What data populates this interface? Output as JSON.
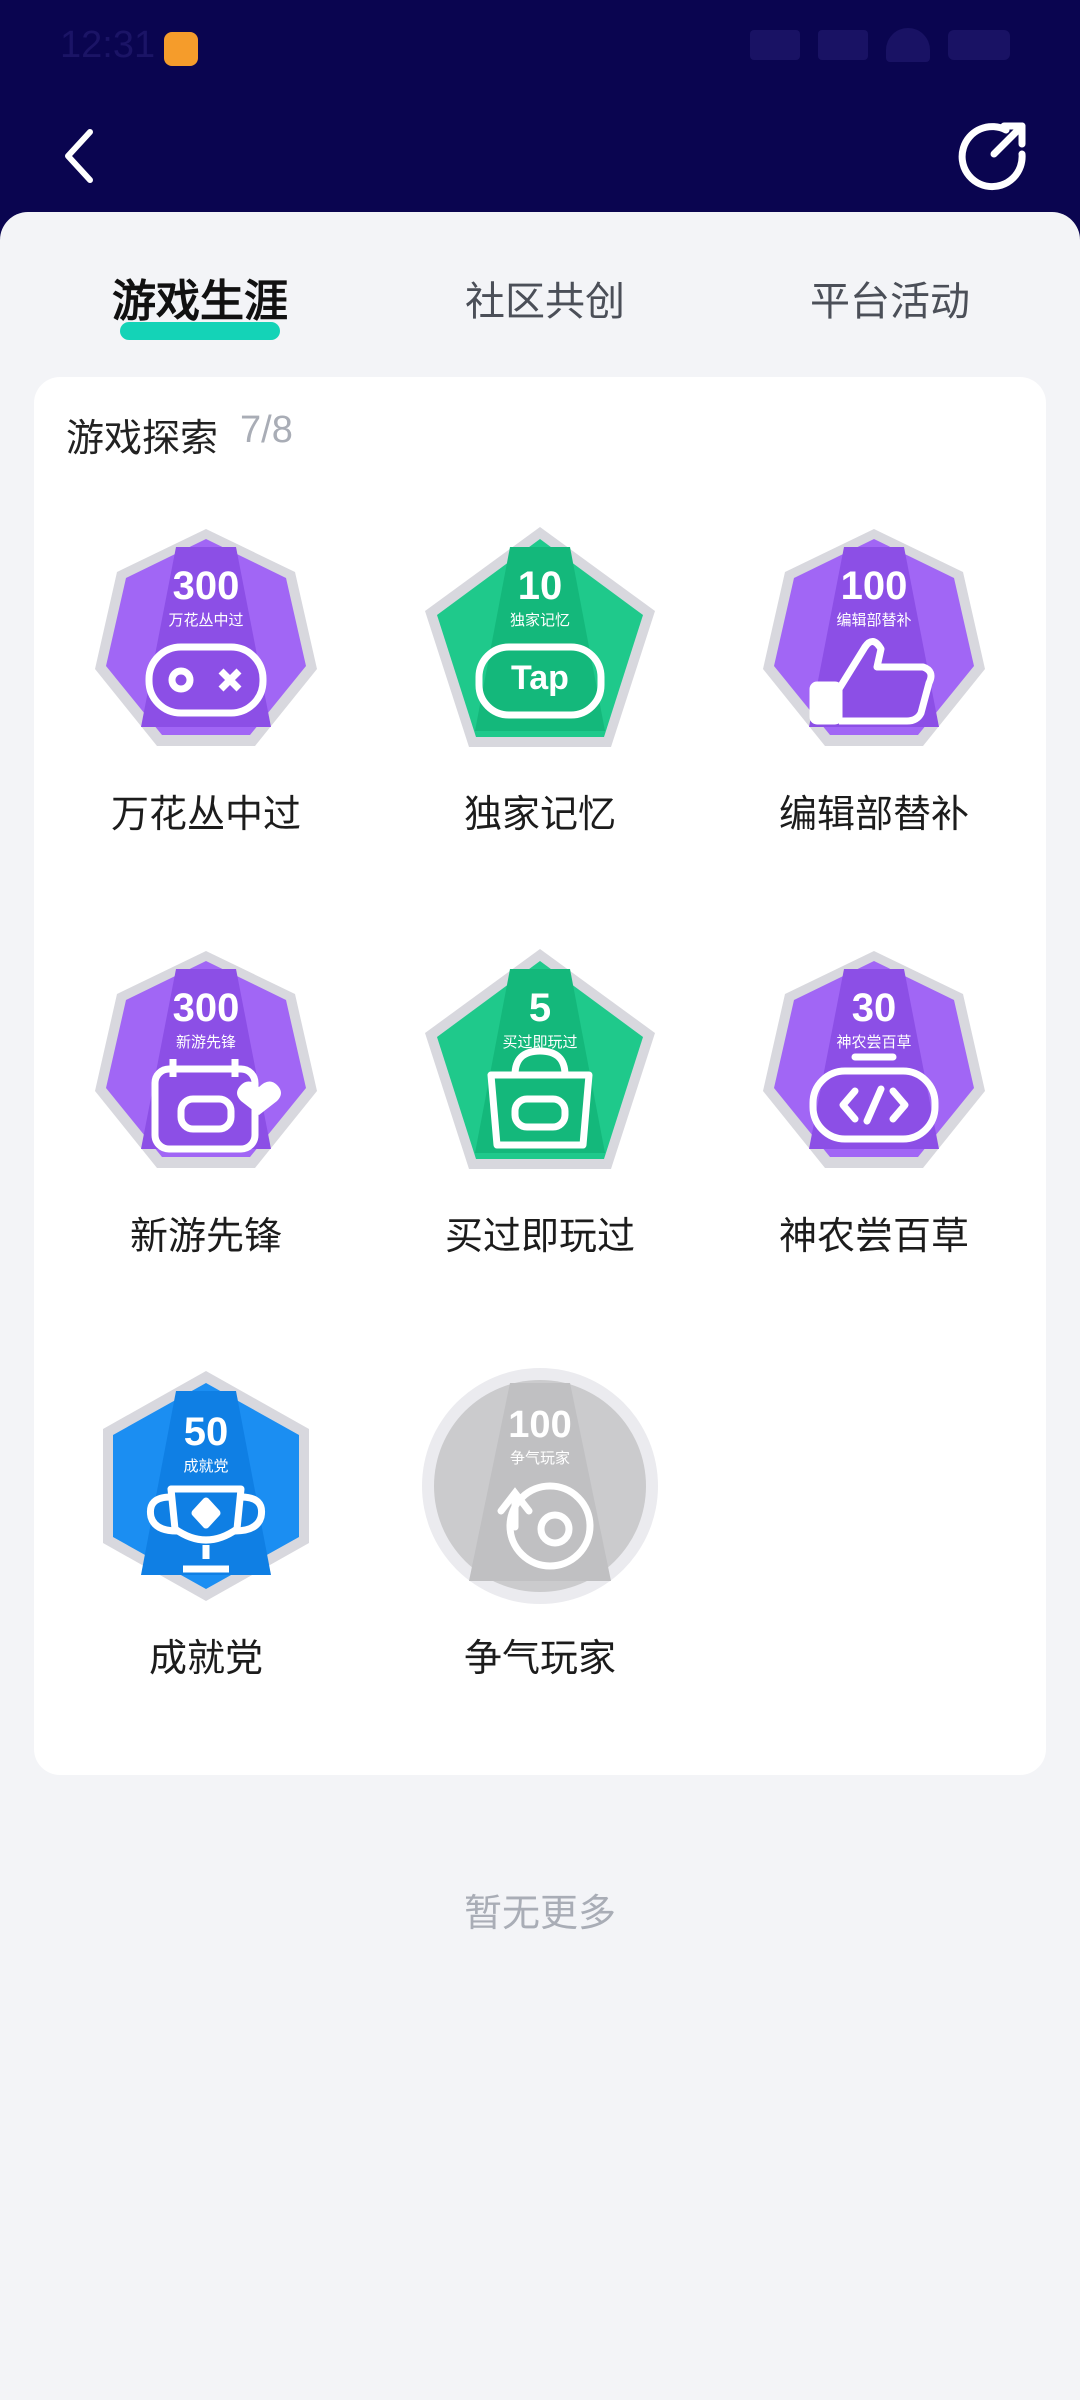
{
  "status": {
    "time": "12:31"
  },
  "tabs": [
    {
      "label": "游戏生涯",
      "active": true
    },
    {
      "label": "社区共创",
      "active": false
    },
    {
      "label": "平台活动",
      "active": false
    }
  ],
  "section": {
    "title": "游戏探索",
    "count": "7/8"
  },
  "badges": [
    {
      "label": "万花丛中过",
      "number": "300",
      "caption": "万花丛中过",
      "shape": "heptagon",
      "color": "purple",
      "icon": "gamepad-icon"
    },
    {
      "label": "独家记忆",
      "number": "10",
      "caption": "独家记忆",
      "shape": "pentagon",
      "color": "green",
      "icon": "tap-icon"
    },
    {
      "label": "编辑部替补",
      "number": "100",
      "caption": "编辑部替补",
      "shape": "heptagon",
      "color": "purple",
      "icon": "thumbs-up-icon"
    },
    {
      "label": "新游先锋",
      "number": "300",
      "caption": "新游先锋",
      "shape": "heptagon",
      "color": "purple",
      "icon": "calendar-icon"
    },
    {
      "label": "买过即玩过",
      "number": "5",
      "caption": "买过即玩过",
      "shape": "pentagon",
      "color": "green",
      "icon": "bag-icon"
    },
    {
      "label": "神农尝百草",
      "number": "30",
      "caption": "神农尝百草",
      "shape": "heptagon",
      "color": "purple",
      "icon": "code-controller-icon"
    },
    {
      "label": "成就党",
      "number": "50",
      "caption": "成就党",
      "shape": "hexagon",
      "color": "blue",
      "icon": "trophy-icon"
    },
    {
      "label": "争气玩家",
      "number": "100",
      "caption": "争气玩家",
      "shape": "circle",
      "color": "gray",
      "icon": "steam-icon"
    }
  ],
  "footer": "暂无更多",
  "colors": {
    "header_bg": "#0a0550",
    "accent": "#14d3b7",
    "purple": "#9a56f2",
    "green": "#1fc98b",
    "blue": "#1b8ef2",
    "gray": "#c9c9c9"
  }
}
